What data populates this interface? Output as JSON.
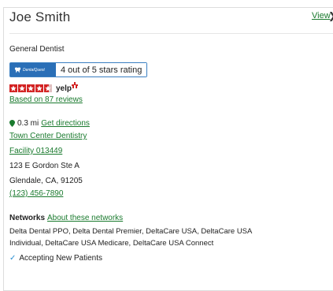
{
  "provider": {
    "name": "Joe Smith",
    "view_link": "View",
    "view_chevron": "❯",
    "specialty": "General Dentist"
  },
  "rating": {
    "badge_label": "DentalQuest",
    "text": "4 out of 5 stars rating",
    "badge_color": "#2a6fb7"
  },
  "yelp": {
    "stars": 4.5,
    "logo": "yelp",
    "reviews_link": "Based on 87 reviews",
    "star_color": "#d32323"
  },
  "location": {
    "distance": "0.3 mi",
    "directions_link": "Get directions",
    "office_name": "Town Center Dentistry",
    "facility_link": "Facility 013449",
    "address_line1": "123 E Gordon Ste A",
    "address_line2": "Glendale, CA, 91205",
    "phone": "(123) 456-7890",
    "pin_icon": "map-pin-icon"
  },
  "networks": {
    "label": "Networks",
    "about_link": "About these networks",
    "list_line1": "Delta Dental PPO, Delta Dental Premier, DeltaCare USA, DeltaCare USA",
    "list_line2": "Individual, DeltaCare USA Medicare, DeltaCare USA Connect"
  },
  "status": {
    "accepting": "Accepting New Patients",
    "check_icon": "checkmark-icon",
    "check_color": "#2a8fd1"
  },
  "colors": {
    "link": "#1a7a2e"
  }
}
